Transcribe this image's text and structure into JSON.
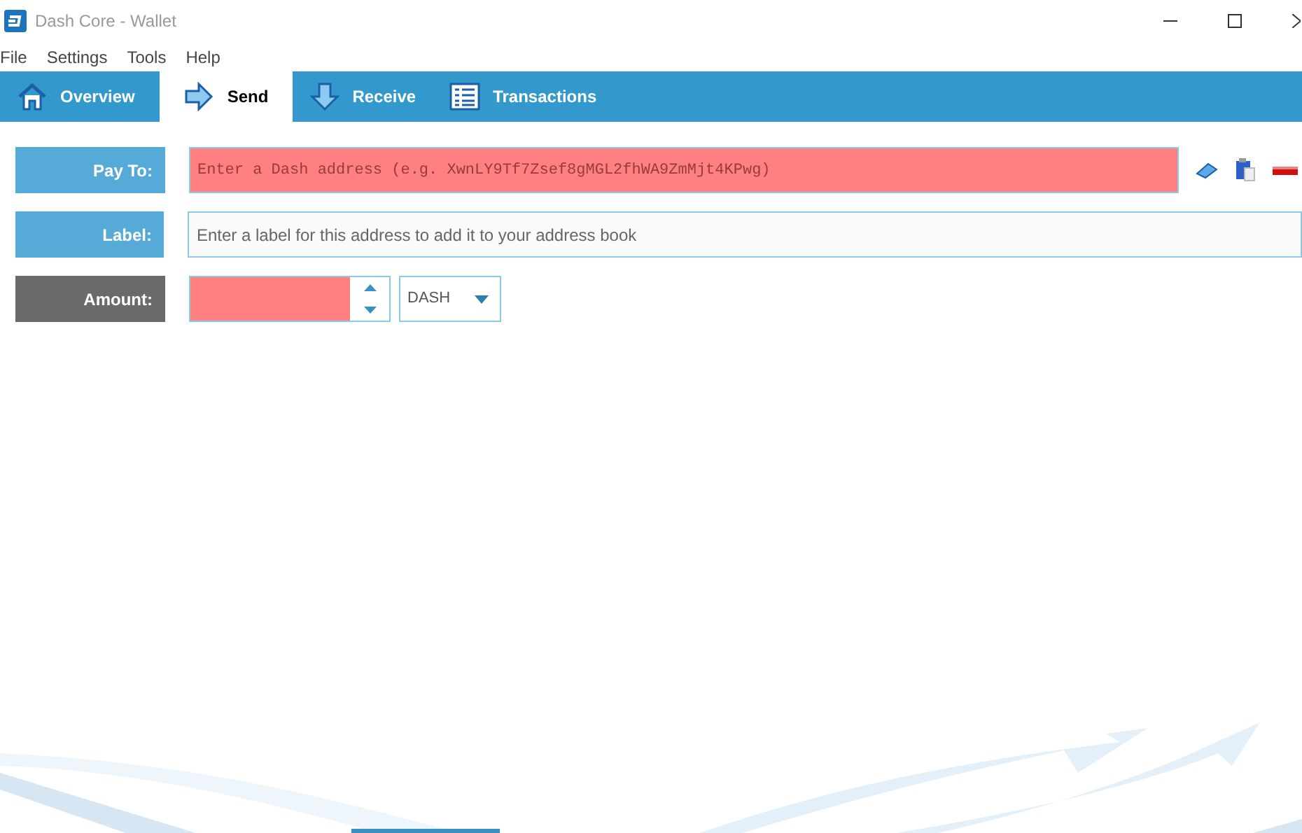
{
  "window": {
    "title": "Dash Core - Wallet"
  },
  "menu": [
    "File",
    "Settings",
    "Tools",
    "Help"
  ],
  "tabs": [
    {
      "kind": "overview",
      "label": "Overview",
      "selected": false
    },
    {
      "kind": "send",
      "label": "Send",
      "selected": true
    },
    {
      "kind": "receive",
      "label": "Receive",
      "selected": false
    },
    {
      "kind": "transactions",
      "label": "Transactions",
      "selected": false
    }
  ],
  "form": [
    {
      "kind": "address",
      "label": "Pay To:",
      "placeholder": "Enter a Dash address (e.g. XwnLY9Tf7Zsef8gMGL2fhWA9ZmMjt4KPwg)",
      "invalid": true
    },
    {
      "kind": "text",
      "label": "Label:",
      "placeholder": "Enter a label for this address to add it to your address book",
      "invalid": false
    },
    {
      "kind": "amount",
      "label": "Amount:",
      "invalid": true,
      "unit": "DASH"
    }
  ]
}
